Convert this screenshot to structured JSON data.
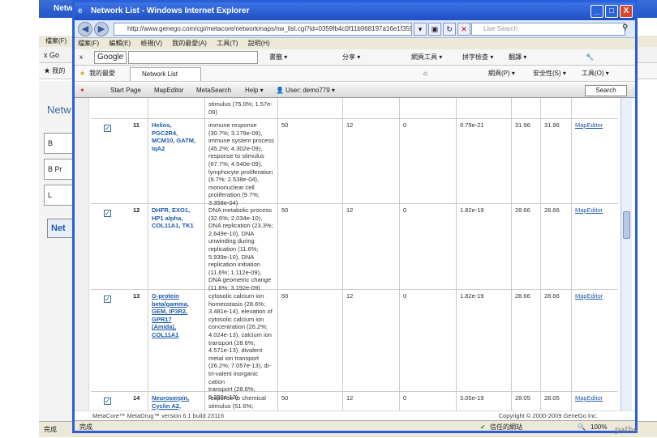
{
  "bg_window": {
    "title": "Netw",
    "menu": [
      "檔案(F)"
    ],
    "google": "Go",
    "fav": "我的",
    "left": [
      "Netw"
    ],
    "items": [
      "B",
      "B Pr",
      "L"
    ],
    "net_label": "Net",
    "status": "完成"
  },
  "window": {
    "title": "Network List - Windows Internet Explorer",
    "url": "http://www.genego.com/cgi/metacore/networkmaps/nw_list.cgi?id=0359fb4c0f11b968197a16e1f359&id=2fcc5781582c8e2953",
    "search_placeholder": "Live Search",
    "menu": [
      "檔案(F)",
      "編輯(E)",
      "檢視(V)",
      "我的最愛(A)",
      "工具(T)",
      "說明(H)"
    ],
    "google_label": "Google",
    "google_items": [
      "書籤 ▾",
      "分享 ▾",
      "網頁工具 ▾",
      "拼字檢查 ▾",
      "翻譯 ▾"
    ],
    "fav_label": "我的最愛",
    "tab_label": "Network List",
    "fav_right": [
      "網頁(P) ▾",
      "安全性(S) ▾",
      "工具(O) ▾"
    ],
    "controls": {
      "min": "_",
      "max": "□",
      "close": "X"
    }
  },
  "appnav": {
    "items": [
      "Start Page",
      "MapEditor",
      "MetaSearch",
      "Help ▾",
      "User: demo779 ▾"
    ],
    "search": "Search"
  },
  "rows": [
    {
      "id": "row-top",
      "num": "",
      "genes": "",
      "go": "stimulus (75.0%; 1.57e-\n09)",
      "nodes": "",
      "seed": "",
      "edges": "",
      "pv": "",
      "z": "",
      "g": "",
      "link": ""
    },
    {
      "id": "row-11",
      "num": "11",
      "genes": "Helios,\nPGC2R4,\nMCM10, GATM,\nIqA2",
      "go": "immune response\n(30.7%; 3.179e-09),\nimmune system process\n(45.2%; 4.302e-09),\nresponse to stimulus\n(67.7%; 4.540e-09),\nlymphocyte proliferation\n(9.7%; 2.538e-04),\nmononuclear cell\nproliferation (9.7%;\n3.358e-04)",
      "nodes": "50",
      "seed": "12",
      "edges": "0",
      "pv": "9.79e-21",
      "z": "31.96",
      "g": "31.96",
      "link": "MapEditor"
    },
    {
      "id": "row-12",
      "num": "12",
      "genes": "DHFR, EXO1,\nHP1 alpha,\nCOL11A1, TK1",
      "go": "DNA metabolic process\n(32.6%; 2.034e-10),\nDNA replication (23.3%;\n2.649e-10), DNA\nunwinding during\nreplication (11.6%;\n5.939e-10), DNA\nreplication initiation\n(11.6%; 1.112e-09),\nDNA geometric change\n(11.6%; 3.192e-09)",
      "nodes": "50",
      "seed": "12",
      "edges": "0",
      "pv": "1.82e-19",
      "z": "28.66",
      "g": "28.66",
      "link": "MapEditor"
    },
    {
      "id": "row-13",
      "num": "13",
      "genes": "G-protein\nbeta/gamma,\nGEM, IP3R2,\nGPR17\n(Amida),\nCOL11A1",
      "go": "cytosolic calcium ion\nhomeostasis (28.6%;\n3.481e-14), elevation of\ncytosolic calcium ion\nconcentration (26.2%;\n4.024e-13), calcium ion\ntransport (28.6%;\n4.571e-13), divalent\nmetal ion transport\n(26.2%; 7.057e-13), di-\ntri-valent inorganic cation\ntransport (28.6%;\n5.398e-12)",
      "nodes": "50",
      "seed": "12",
      "edges": "0",
      "pv": "1.82e-19",
      "z": "28.66",
      "g": "28.66",
      "link": "MapEditor"
    },
    {
      "id": "row-14",
      "num": "14",
      "genes": "Neuroserpin,\nCyclin A2,",
      "go": "response to chemical\nstimulus (51.6%; 1.841e-",
      "nodes": "50",
      "seed": "12",
      "edges": "0",
      "pv": "3.05e-19",
      "z": "28.05",
      "g": "28.05",
      "link": "MapEditor"
    }
  ],
  "footer": {
    "left": "MetaCore™ MetaDrug™ version 6.1 build 23116",
    "right": "Copyright © 2000-2009 GeneGo Inc."
  },
  "status": {
    "left": "完成",
    "zone": "信任的網站",
    "zoom": "100%"
  },
  "watermark": "paths"
}
